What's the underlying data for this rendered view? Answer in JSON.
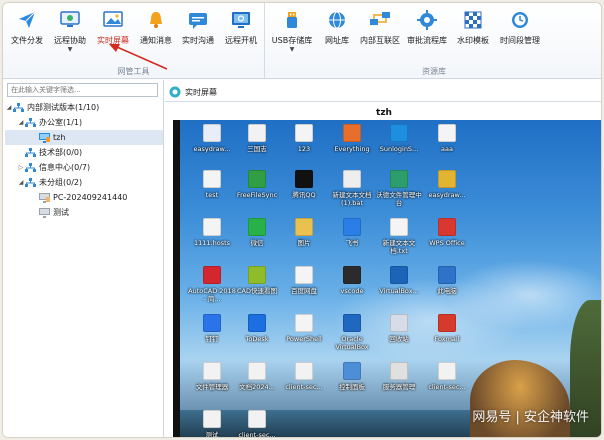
{
  "ribbon": {
    "group1": {
      "label": "网管工具",
      "buttons": [
        {
          "label": "文件分发",
          "icon": "paper-plane-icon"
        },
        {
          "label": "远程协助",
          "icon": "remote-assist-icon",
          "has_dropdown": true
        },
        {
          "label": "实时屏幕",
          "icon": "screen-image-icon",
          "active": true
        },
        {
          "label": "通知消息",
          "icon": "bell-icon"
        },
        {
          "label": "实时沟通",
          "icon": "chat-icon"
        },
        {
          "label": "远程开机",
          "icon": "remote-power-icon"
        }
      ]
    },
    "group2": {
      "label": "资源库",
      "buttons": [
        {
          "label": "USB存储库",
          "icon": "usb-icon",
          "has_dropdown": true
        },
        {
          "label": "网址库",
          "icon": "globe-icon"
        },
        {
          "label": "内部互联区",
          "icon": "network-icon"
        },
        {
          "label": "审批流程库",
          "icon": "gear-blue-icon"
        },
        {
          "label": "水印模板",
          "icon": "watermark-grid-icon"
        },
        {
          "label": "时间段管理",
          "icon": "clock-gear-icon"
        }
      ]
    },
    "accent_color": "#c42b1c"
  },
  "left_panel": {
    "search_placeholder": "在此输入关键字筛选...",
    "tree": [
      {
        "label": "内部测试版本(1/10)",
        "level": 0,
        "expanded": true,
        "icon": "org-icon"
      },
      {
        "label": "办公室(1/1)",
        "level": 1,
        "expanded": true,
        "icon": "org-icon"
      },
      {
        "label": "tzh",
        "level": 2,
        "icon": "computer-online-icon",
        "selected": true
      },
      {
        "label": "技术部(0/0)",
        "level": 1,
        "icon": "org-icon"
      },
      {
        "label": "信息中心(0/7)",
        "level": 1,
        "collapsed": true,
        "icon": "org-icon"
      },
      {
        "label": "未分组(0/2)",
        "level": 1,
        "expanded": true,
        "icon": "org-icon"
      },
      {
        "label": "PC-202409241440",
        "level": 2,
        "icon": "computer-offline-icon"
      },
      {
        "label": "测试",
        "level": 2,
        "icon": "computer-offline-icon"
      }
    ]
  },
  "right_panel": {
    "tab_label": "实时屏幕",
    "screen_title": "tzh",
    "desktop_icons": [
      {
        "label": "easydraw...",
        "color": "#e9eef6"
      },
      {
        "label": "三国志",
        "color": "#f2f2f2"
      },
      {
        "label": "123",
        "color": "#f4f4f4"
      },
      {
        "label": "Everything",
        "color": "#e86f2b"
      },
      {
        "label": "SunloginS...",
        "color": "#1d8ee0"
      },
      {
        "label": "aaa",
        "color": "#f4f4f4"
      },
      {
        "label": "test",
        "color": "#f4f4f4"
      },
      {
        "label": "FreeFileSync",
        "color": "#2f9e44"
      },
      {
        "label": "腾讯QQ",
        "color": "#111111"
      },
      {
        "label": "新建文本文档(1).bat",
        "color": "#eeeeee"
      },
      {
        "label": "沃德文件管理中台",
        "color": "#2c9e6b"
      },
      {
        "label": "easydraw...",
        "color": "#e1b431"
      },
      {
        "label": "1111.hosts",
        "color": "#f4f4f4"
      },
      {
        "label": "微信",
        "color": "#27b148"
      },
      {
        "label": "图片",
        "color": "#e8c150"
      },
      {
        "label": "飞书",
        "color": "#2a7ee6"
      },
      {
        "label": "新建文本文档.txt",
        "color": "#f4f4f4"
      },
      {
        "label": "WPS Office",
        "color": "#d8382f"
      },
      {
        "label": "AutoCAD 2018 - 简...",
        "color": "#d3262f"
      },
      {
        "label": "CAD快速看图",
        "color": "#8fbc2a"
      },
      {
        "label": "百度网盘",
        "color": "#f4f4f4"
      },
      {
        "label": "vscode",
        "color": "#2b2b2b"
      },
      {
        "label": "VirtualBox...",
        "color": "#1c64b8"
      },
      {
        "label": "此电脑",
        "color": "#2e73c9"
      },
      {
        "label": "钉钉",
        "color": "#2b73e8"
      },
      {
        "label": "ToDesk",
        "color": "#1b6fe0"
      },
      {
        "label": "PowerShell",
        "color": "#f4f4f4"
      },
      {
        "label": "Oracle VirtualBox",
        "color": "#1f67bf"
      },
      {
        "label": "回收站",
        "color": "#d7dde6"
      },
      {
        "label": "Foxmail",
        "color": "#d63a2b"
      },
      {
        "label": "文件管理器",
        "color": "#f2f2f2"
      },
      {
        "label": "文档2024...",
        "color": "#f2f2f2"
      },
      {
        "label": "client-sec...",
        "color": "#f2f2f2"
      },
      {
        "label": "控制面板",
        "color": "#4d8ed6"
      },
      {
        "label": "服务器管理",
        "color": "#e0e0e0"
      },
      {
        "label": "client-sec...",
        "color": "#f2f2f2"
      },
      {
        "label": "测试",
        "color": "#f2f2f2"
      },
      {
        "label": "client-sec...",
        "color": "#f2f2f2"
      }
    ],
    "watermark": "网易号 | 安企神软件"
  }
}
